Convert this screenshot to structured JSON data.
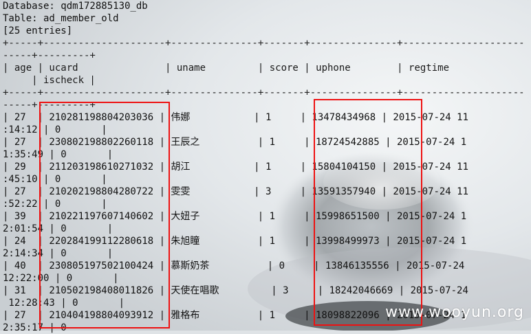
{
  "db_line": "Database: qdm172885130_db",
  "table_line": "Table: ad_member_old",
  "entries_line": "[25 entries]",
  "separator_a": "+-----+---------------------+---------------+-------+---------------+---------------------",
  "separator_b": "-----+---------+",
  "header_a": "| age | ucard               | uname         | score | uphone        | regtime",
  "header_b": "     | ischeck |",
  "rows": [
    {
      "a": "| 27  | 210281198804203036 | 伟娜           | 1     | 13478434968 | 2015-07-24 11",
      "b": ":14:12 | 0       |"
    },
    {
      "a": "| 27  | 230802198802260118 | 王辰之          | 1     | 18724542885 | 2015-07-24 1",
      "b": "1:35:49 | 0       |"
    },
    {
      "a": "| 29  | 211203198610271032 | 胡江           | 1     | 15804104150 | 2015-07-24 11",
      "b": ":45:10 | 0       |"
    },
    {
      "a": "| 27  | 210202198804280722 | 雯雯           | 3     | 13591357940 | 2015-07-24 11",
      "b": ":52:22 | 0       |"
    },
    {
      "a": "| 39  | 210221197607140602 | 大妞子          | 1     | 15998651500 | 2015-07-24 1",
      "b": "2:01:54 | 0       |"
    },
    {
      "a": "| 24  | 220284199112280618 | 朱旭瞳          | 1     | 13998499973 | 2015-07-24 1",
      "b": "2:14:34 | 0       |"
    },
    {
      "a": "| 40  | 230805197502100424 | 慕斯奶茶          | 0     | 13846135556 | 2015-07-24",
      "b": "12:22:00 | 0       |"
    },
    {
      "a": "| 31  | 210502198408011826 | 天使在唱歌         | 3     | 18242046669 | 2015-07-24",
      "b": " 12:28:43 | 0       |"
    },
    {
      "a": "| 27  | 210404198804093912 | 雅格布          | 1     | 18098822096 | 2015-07-24 1",
      "b": "2:35:17 | 0"
    }
  ],
  "watermark": "www.wooyun.org",
  "colors": {
    "highlight_box": "#e11111",
    "terminal_text": "#111111",
    "background": "#dfe3e6"
  }
}
